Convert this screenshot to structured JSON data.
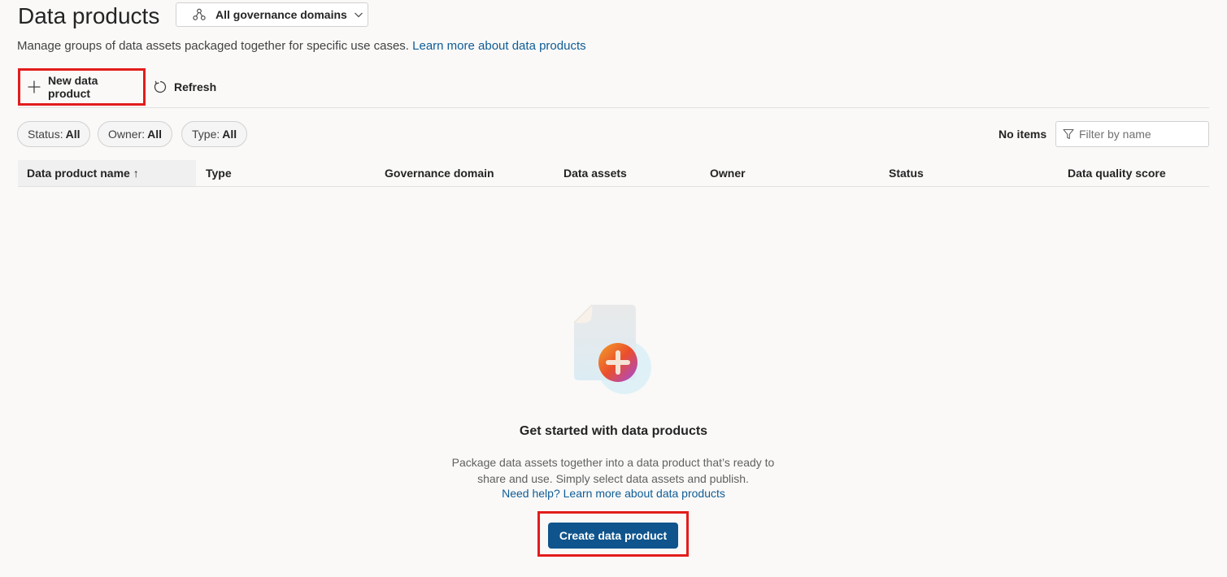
{
  "header": {
    "title": "Data products",
    "domain_selector": {
      "label": "All governance domains",
      "icon": "org-hierarchy-icon"
    },
    "subtitle": "Manage groups of data assets packaged together for specific use cases.",
    "subtitle_link": "Learn more about data products"
  },
  "toolbar": {
    "new_label": "New data product",
    "refresh_label": "Refresh"
  },
  "filters": [
    {
      "key": "Status:",
      "value": "All"
    },
    {
      "key": "Owner:",
      "value": "All"
    },
    {
      "key": "Type:",
      "value": "All"
    }
  ],
  "item_count": "No items",
  "search": {
    "placeholder": "Filter by name"
  },
  "table": {
    "columns": [
      "Data product name ↑",
      "Type",
      "Governance domain",
      "Data assets",
      "Owner",
      "Status",
      "Data quality score"
    ]
  },
  "empty_state": {
    "title": "Get started with data products",
    "description_line1": "Package data assets together into a data product that’s ready to",
    "description_line2": "share and use. Simply select data assets and publish.",
    "help_link": "Need help? Learn more about data products",
    "cta": "Create data product"
  },
  "colors": {
    "accent": "#0f548c",
    "link": "#0f5c96",
    "highlight": "#e31c1c"
  }
}
